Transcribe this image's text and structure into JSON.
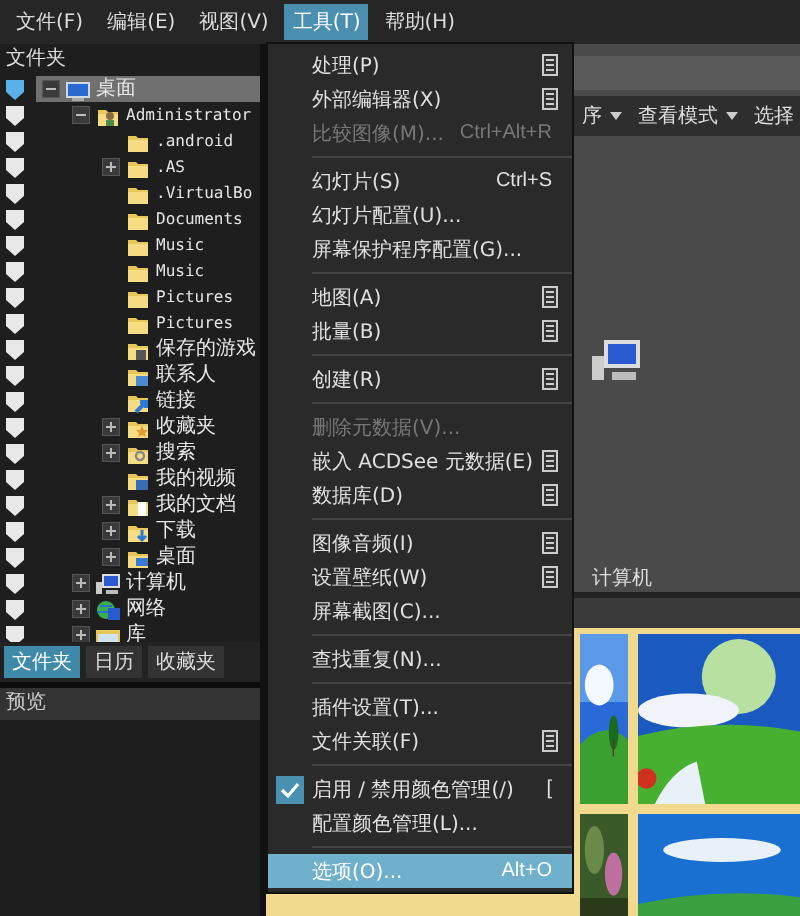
{
  "menubar": [
    {
      "label": "文件(F)",
      "selected": false
    },
    {
      "label": "编辑(E)",
      "selected": false
    },
    {
      "label": "视图(V)",
      "selected": false
    },
    {
      "label": "工具(T)",
      "selected": true
    },
    {
      "label": "帮助(H)",
      "selected": false
    }
  ],
  "folders_panel": {
    "title": "文件夹",
    "tree": [
      {
        "label": "桌面",
        "kind": "desktop",
        "expandable": true,
        "expanded": true,
        "selected": true,
        "children": [
          {
            "label": "Administrator",
            "kind": "user",
            "expandable": true,
            "expanded": true,
            "selected": false,
            "children": [
              {
                "label": ".android",
                "kind": "folder",
                "expandable": false,
                "selected": false
              },
              {
                "label": ".AS",
                "kind": "folder",
                "expandable": true,
                "expanded": false,
                "selected": false
              },
              {
                "label": ".VirtualBo",
                "kind": "folder",
                "expandable": false,
                "selected": false
              },
              {
                "label": "Documents",
                "kind": "folder",
                "expandable": false,
                "selected": false
              },
              {
                "label": "Music",
                "kind": "folder",
                "expandable": false,
                "selected": false
              },
              {
                "label": "Music",
                "kind": "folder",
                "expandable": false,
                "selected": false
              },
              {
                "label": "Pictures",
                "kind": "folder",
                "expandable": false,
                "selected": false
              },
              {
                "label": "Pictures",
                "kind": "folder",
                "expandable": false,
                "selected": false
              },
              {
                "label": "保存的游戏",
                "kind": "games",
                "expandable": false,
                "selected": false
              },
              {
                "label": "联系人",
                "kind": "contacts",
                "expandable": false,
                "selected": false
              },
              {
                "label": "链接",
                "kind": "links",
                "expandable": false,
                "selected": false
              },
              {
                "label": "收藏夹",
                "kind": "favorites",
                "expandable": true,
                "expanded": false,
                "selected": false
              },
              {
                "label": "搜索",
                "kind": "search",
                "expandable": true,
                "expanded": false,
                "selected": false
              },
              {
                "label": "我的视频",
                "kind": "videos",
                "expandable": false,
                "selected": false
              },
              {
                "label": "我的文档",
                "kind": "documents",
                "expandable": true,
                "expanded": false,
                "selected": false
              },
              {
                "label": "下载",
                "kind": "downloads",
                "expandable": true,
                "expanded": false,
                "selected": false
              },
              {
                "label": "桌面",
                "kind": "desktopfolder",
                "expandable": true,
                "expanded": false,
                "selected": false
              }
            ]
          },
          {
            "label": "计算机",
            "kind": "computer",
            "expandable": true,
            "expanded": false,
            "selected": false
          },
          {
            "label": "网络",
            "kind": "network",
            "expandable": true,
            "expanded": false,
            "selected": false
          },
          {
            "label": "库",
            "kind": "library",
            "expandable": true,
            "expanded": false,
            "selected": false
          }
        ]
      }
    ]
  },
  "panel_tabs": [
    {
      "label": "文件夹",
      "selected": true
    },
    {
      "label": "日历",
      "selected": false
    },
    {
      "label": "收藏夹",
      "selected": false
    }
  ],
  "preview_panel": {
    "title": "预览"
  },
  "tools_menu": [
    {
      "kind": "item",
      "label": "处理(P)",
      "submenu": true,
      "disabled": false,
      "checked": false,
      "selected": false
    },
    {
      "kind": "item",
      "label": "外部编辑器(X)",
      "submenu": true,
      "disabled": false,
      "checked": false,
      "selected": false
    },
    {
      "kind": "item",
      "label": "比较图像(M)...",
      "shortcut": "Ctrl+Alt+R",
      "submenu": false,
      "disabled": true,
      "checked": false,
      "selected": false
    },
    {
      "kind": "separator"
    },
    {
      "kind": "item",
      "label": "幻灯片(S)",
      "shortcut": "Ctrl+S",
      "submenu": false,
      "disabled": false,
      "checked": false,
      "selected": false
    },
    {
      "kind": "item",
      "label": "幻灯片配置(U)...",
      "submenu": false,
      "disabled": false,
      "checked": false,
      "selected": false
    },
    {
      "kind": "item",
      "label": "屏幕保护程序配置(G)...",
      "submenu": false,
      "disabled": false,
      "checked": false,
      "selected": false
    },
    {
      "kind": "separator"
    },
    {
      "kind": "item",
      "label": "地图(A)",
      "submenu": true,
      "disabled": false,
      "checked": false,
      "selected": false
    },
    {
      "kind": "item",
      "label": "批量(B)",
      "submenu": true,
      "disabled": false,
      "checked": false,
      "selected": false
    },
    {
      "kind": "separator"
    },
    {
      "kind": "item",
      "label": "创建(R)",
      "submenu": true,
      "disabled": false,
      "checked": false,
      "selected": false
    },
    {
      "kind": "separator"
    },
    {
      "kind": "item",
      "label": "删除元数据(V)...",
      "submenu": false,
      "disabled": true,
      "checked": false,
      "selected": false
    },
    {
      "kind": "item",
      "label": "嵌入 ACDSee 元数据(E)",
      "submenu": true,
      "disabled": false,
      "checked": false,
      "selected": false
    },
    {
      "kind": "item",
      "label": "数据库(D)",
      "submenu": true,
      "disabled": false,
      "checked": false,
      "selected": false
    },
    {
      "kind": "separator"
    },
    {
      "kind": "item",
      "label": "图像音频(I)",
      "submenu": true,
      "disabled": false,
      "checked": false,
      "selected": false
    },
    {
      "kind": "item",
      "label": "设置壁纸(W)",
      "submenu": true,
      "disabled": false,
      "checked": false,
      "selected": false
    },
    {
      "kind": "item",
      "label": "屏幕截图(C)...",
      "submenu": false,
      "disabled": false,
      "checked": false,
      "selected": false
    },
    {
      "kind": "separator"
    },
    {
      "kind": "item",
      "label": "查找重复(N)...",
      "submenu": false,
      "disabled": false,
      "checked": false,
      "selected": false
    },
    {
      "kind": "separator"
    },
    {
      "kind": "item",
      "label": "插件设置(T)...",
      "submenu": false,
      "disabled": false,
      "checked": false,
      "selected": false
    },
    {
      "kind": "item",
      "label": "文件关联(F)",
      "submenu": true,
      "disabled": false,
      "checked": false,
      "selected": false
    },
    {
      "kind": "separator"
    },
    {
      "kind": "item",
      "label": "启用 / 禁用颜色管理(/)",
      "shortcut": "[",
      "submenu": false,
      "disabled": false,
      "checked": true,
      "selected": false
    },
    {
      "kind": "item",
      "label": "配置颜色管理(L)...",
      "submenu": false,
      "disabled": false,
      "checked": false,
      "selected": false
    },
    {
      "kind": "separator"
    },
    {
      "kind": "item",
      "label": "选项(O)...",
      "shortcut": "Alt+O",
      "submenu": false,
      "disabled": false,
      "checked": false,
      "selected": true
    }
  ],
  "toolbar": [
    {
      "label": "序",
      "dropdown": true
    },
    {
      "label": "查看模式",
      "dropdown": true
    },
    {
      "label": "选择",
      "dropdown": false
    }
  ],
  "content": {
    "items": [
      {
        "label": "计算机",
        "kind": "computer"
      }
    ]
  }
}
